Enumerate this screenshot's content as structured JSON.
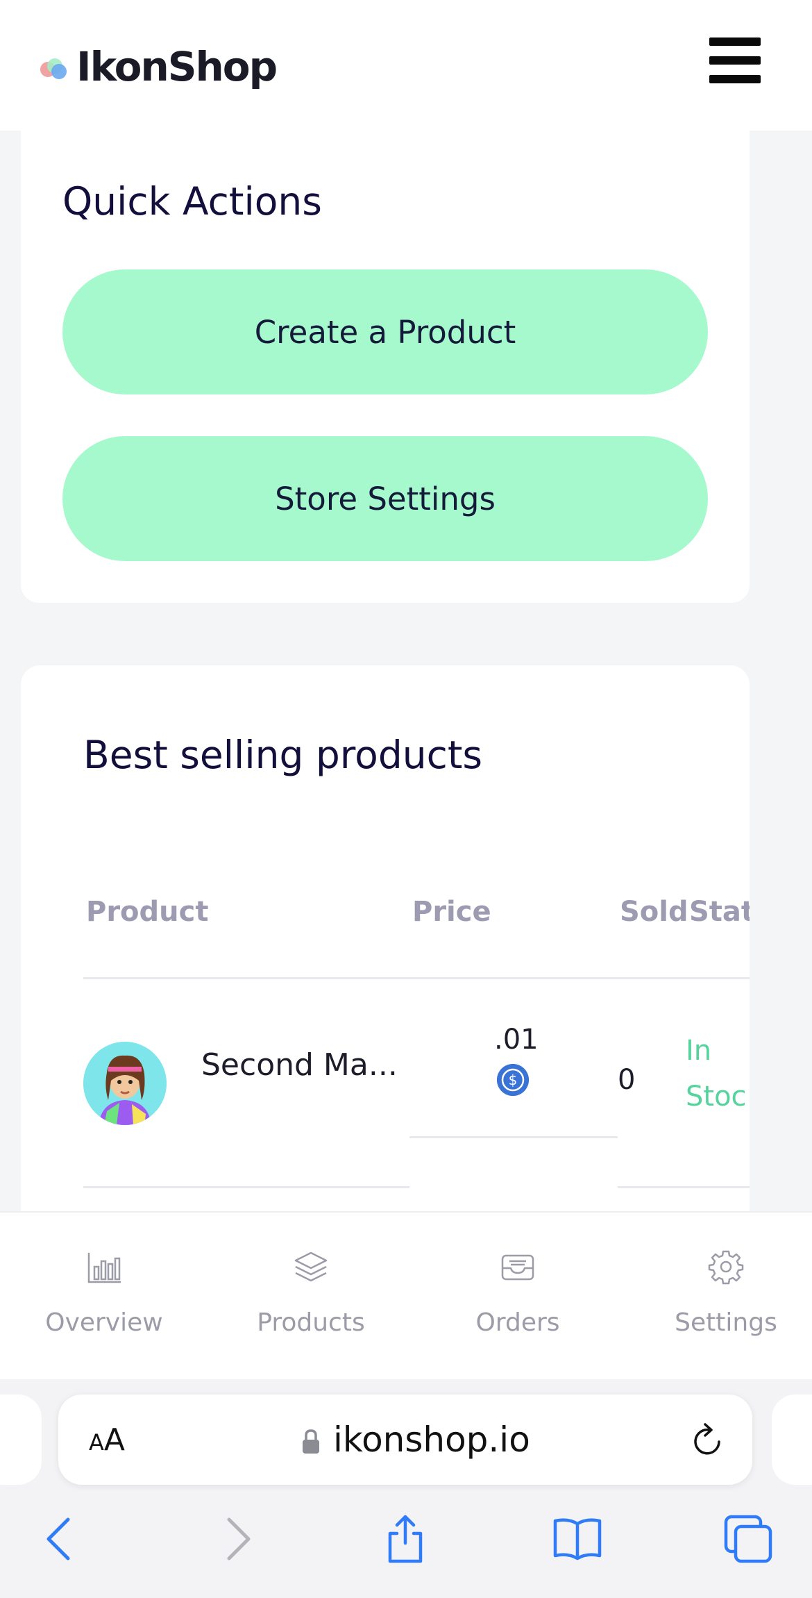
{
  "header": {
    "logo_text": "IkonShop",
    "menu_icon": "hamburger-menu-icon"
  },
  "quick_actions": {
    "title": "Quick Actions",
    "create_product_label": "Create a Product",
    "store_settings_label": "Store Settings"
  },
  "best_selling": {
    "title": "Best selling products",
    "columns": [
      "Product",
      "Price",
      "Sold",
      "Stat"
    ],
    "rows": [
      {
        "product": "Second Ma...",
        "price": ".01",
        "price_currency_icon": "usdc-coin-icon",
        "sold": "0",
        "status_line1": "In",
        "status_line2": "Stoc"
      }
    ]
  },
  "tabbar": {
    "tabs": [
      {
        "label": "Overview",
        "icon": "bar-chart-icon"
      },
      {
        "label": "Products",
        "icon": "layers-icon"
      },
      {
        "label": "Orders",
        "icon": "inbox-icon"
      },
      {
        "label": "Settings",
        "icon": "gear-icon"
      }
    ]
  },
  "browser": {
    "aa_label_small": "A",
    "aa_label_large": "A",
    "url": "ikonshop.io"
  },
  "colors": {
    "accent_button": "#a6f9cc",
    "title_text": "#130f3c",
    "status_green": "#55d39d",
    "link_blue": "#2f7cf6"
  }
}
